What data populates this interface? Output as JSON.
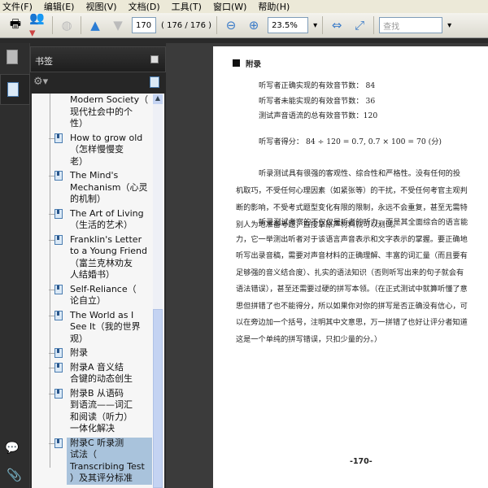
{
  "menu": [
    "文件(F)",
    "编辑(E)",
    "视图(V)",
    "文档(D)",
    "工具(T)",
    "窗口(W)",
    "帮助(H)"
  ],
  "toolbar": {
    "page_value": "170",
    "page_count": "( 176 / 176 )",
    "zoom": "23.5%",
    "search_placeholder": "查找"
  },
  "panel": {
    "title": "书签"
  },
  "bookmarks": [
    {
      "lines": [
        "Modern Society（",
        "现代社会中的个",
        "性）"
      ],
      "icon": false
    },
    {
      "lines": [
        " How to grow old",
        "（怎样慢慢变",
        "老）"
      ],
      "icon": true
    },
    {
      "lines": [
        " The Mind's",
        "Mechanism（心灵",
        "的机制）"
      ],
      "icon": true
    },
    {
      "lines": [
        " The Art of Living",
        "（生活的艺术）"
      ],
      "icon": true
    },
    {
      "lines": [
        " Franklin's Letter",
        "to a Young Friend",
        "（富兰克林劝友",
        "人结婚书）"
      ],
      "icon": true
    },
    {
      "lines": [
        " Self-Reliance（",
        "论自立）"
      ],
      "icon": true
    },
    {
      "lines": [
        " The World as I",
        "See It（我的世界",
        "观）"
      ],
      "icon": true
    },
    {
      "lines": [
        "附录"
      ],
      "icon": true
    },
    {
      "lines": [
        " 附录A 音义结",
        "合键的动态创生"
      ],
      "icon": true
    },
    {
      "lines": [
        " 附录B 从语码",
        "到语流——词汇",
        "和阅读（听力）",
        "一体化解决"
      ],
      "icon": true
    },
    {
      "lines": [
        " 附录C 听录测",
        "试法（",
        "Transcribing Test",
        "）及其评分标准"
      ],
      "icon": true,
      "selected": true
    }
  ],
  "document": {
    "header": "附录",
    "stats": [
      "听写者正确实现的有效音节数：  84",
      "听写者未能实现的有效音节数：  36",
      "测试声音语流的总有效音节数：120"
    ],
    "score": "听写者得分：  84 ÷ 120 = 0.7,  0.7 × 100 = 70 (分)",
    "para1": [
      "听录测试具有很强的客观性、综合性和严格性。没有任何的投",
      "机取巧，不受任何心理因素（如紧张等）的干扰，不受任何考官主观判",
      "断的影响，不受考式题型变化有限的限制，永远不会重复，甚至无需特",
      "别人为地准备考题，直接拿原声材料就可以测试。"
    ],
    "para2": [
      "听录测试考察的不仅仅是听者的听力，而是其全面综合的语言能",
      "力，它一举测出听者对于该语言声音表示和文字表示的掌握。要正确地",
      "听写出录音稿，需要对声音材料的正确理解、丰富的词汇量（而且要有",
      "足够强的音义结合度）、扎实的语法知识（否则听写出来的句子就会有",
      "语法错误），甚至还需要过硬的拼写本领。（在正式测试中就算听懂了意",
      "思但拼错了也不能得分，所以如果你对你的拼写是否正确没有信心，可",
      "以在旁边加一个括号，注明其中文意思，万一拼错了也好让评分者知道",
      "这是一个单纯的拼写错误，只扣少量的分。）"
    ],
    "page_number": "-170-"
  }
}
